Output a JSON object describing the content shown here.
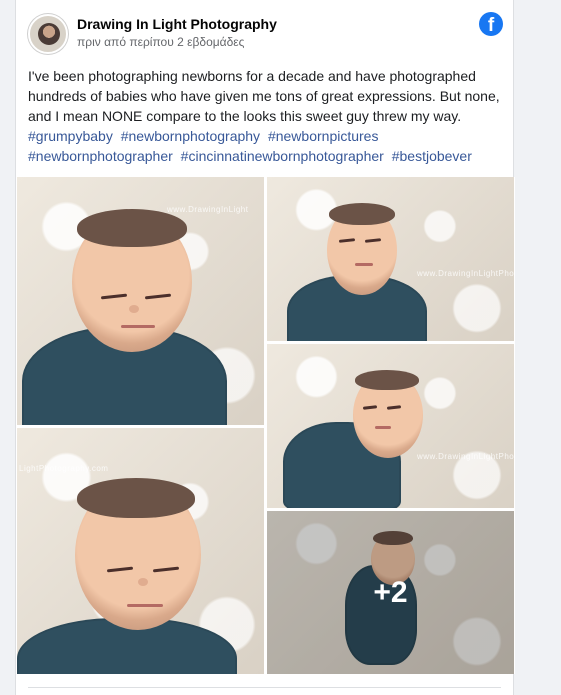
{
  "post": {
    "page_name": "Drawing In Light Photography",
    "time": "πριν από περίπου 2 εβδομάδες",
    "text": "I've been photographing newborns for a decade and have photographed hundreds of babies who have given me tons of great expressions. But none, and I mean NONE compare to the looks this sweet guy threw my way.",
    "hashtags": [
      "#grumpybaby",
      "#newbornphotography",
      "#newbornpictures",
      "#newbornphotographer",
      "#cincinnatinewbornphotographer",
      "#bestjobever"
    ],
    "brand_icon": "facebook-icon",
    "avatar_icon": "profile-photo"
  },
  "gallery": {
    "more_count": "+2",
    "watermarks": [
      "www.DrawingInLight",
      "www.DrawingInLightPhotography.com",
      "www.DrawingInLightPhotography.com",
      "LightPhotography.com"
    ],
    "colors": {
      "blanket": "#2f4f5f",
      "fur": "#efe9df",
      "brand_blue": "#1877f2",
      "hashtag_blue": "#385898"
    }
  }
}
